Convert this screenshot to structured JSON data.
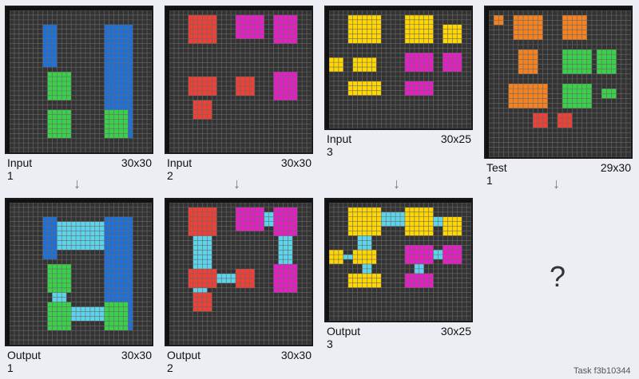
{
  "background": "#eceef4",
  "colors": {
    "0": "#333333",
    "1": "#1e6fd6",
    "2": "#ee4036",
    "3": "#3ad14a",
    "4": "#ffd600",
    "6": "#e51ec3",
    "7": "#f5821f",
    "8": "#5cd4ec"
  },
  "arrow_glyph": "↓",
  "question_mark": "?",
  "task_label": "Task f3b10344",
  "panels": [
    {
      "id": "input-1",
      "label": "Input 1",
      "dims": "30x30",
      "w": 30,
      "h": 30,
      "rects": [
        [
          1,
          3,
          7,
          11,
          9
        ],
        [
          1,
          3,
          20,
          26,
          25
        ],
        [
          3,
          13,
          8,
          18,
          12
        ],
        [
          3,
          21,
          8,
          26,
          12
        ],
        [
          3,
          21,
          20,
          26,
          24
        ]
      ]
    },
    {
      "id": "input-2",
      "label": "Input 2",
      "dims": "30x30",
      "w": 30,
      "h": 30,
      "rects": [
        [
          2,
          1,
          4,
          6,
          9
        ],
        [
          6,
          1,
          14,
          5,
          19
        ],
        [
          6,
          1,
          22,
          6,
          26
        ],
        [
          2,
          14,
          4,
          17,
          9
        ],
        [
          2,
          14,
          14,
          17,
          17
        ],
        [
          6,
          13,
          22,
          18,
          26
        ],
        [
          2,
          19,
          5,
          22,
          8
        ]
      ]
    },
    {
      "id": "input-3",
      "label": "Input 3",
      "dims": "30x25",
      "w": 30,
      "h": 25,
      "rects": [
        [
          4,
          1,
          4,
          6,
          10
        ],
        [
          4,
          1,
          16,
          6,
          21
        ],
        [
          4,
          3,
          24,
          6,
          27
        ],
        [
          4,
          10,
          0,
          12,
          2
        ],
        [
          4,
          10,
          5,
          12,
          9
        ],
        [
          6,
          9,
          16,
          12,
          21
        ],
        [
          6,
          9,
          24,
          12,
          27
        ],
        [
          4,
          15,
          4,
          17,
          10
        ],
        [
          6,
          15,
          16,
          17,
          21
        ]
      ]
    },
    {
      "id": "test-1",
      "label": "Test 1",
      "dims": "29x30",
      "w": 29,
      "h": 30,
      "rects": [
        [
          7,
          1,
          1,
          2,
          2
        ],
        [
          7,
          1,
          5,
          5,
          10
        ],
        [
          7,
          1,
          15,
          5,
          19
        ],
        [
          7,
          8,
          6,
          12,
          9
        ],
        [
          3,
          8,
          15,
          12,
          20
        ],
        [
          3,
          8,
          22,
          12,
          25
        ],
        [
          7,
          15,
          4,
          19,
          11
        ],
        [
          3,
          15,
          15,
          19,
          20
        ],
        [
          3,
          16,
          23,
          17,
          25
        ],
        [
          2,
          21,
          9,
          23,
          11
        ],
        [
          2,
          21,
          14,
          23,
          16
        ]
      ]
    },
    {
      "id": "output-1",
      "label": "Output 1",
      "dims": "30x30",
      "w": 30,
      "h": 30,
      "rects": [
        [
          1,
          3,
          7,
          11,
          9
        ],
        [
          8,
          4,
          10,
          9,
          19
        ],
        [
          1,
          3,
          20,
          26,
          25
        ],
        [
          3,
          13,
          8,
          18,
          12
        ],
        [
          8,
          19,
          9,
          20,
          11
        ],
        [
          3,
          21,
          8,
          26,
          12
        ],
        [
          8,
          22,
          13,
          24,
          19
        ],
        [
          3,
          21,
          20,
          26,
          24
        ]
      ]
    },
    {
      "id": "output-2",
      "label": "Output 2",
      "dims": "30x30",
      "w": 30,
      "h": 30,
      "rects": [
        [
          2,
          1,
          4,
          6,
          9
        ],
        [
          8,
          7,
          5,
          13,
          8
        ],
        [
          6,
          1,
          14,
          5,
          19
        ],
        [
          8,
          2,
          20,
          4,
          21
        ],
        [
          6,
          1,
          22,
          6,
          26
        ],
        [
          8,
          7,
          23,
          12,
          25
        ],
        [
          2,
          14,
          4,
          17,
          9
        ],
        [
          8,
          15,
          10,
          16,
          13
        ],
        [
          2,
          14,
          14,
          17,
          17
        ],
        [
          6,
          13,
          22,
          18,
          26
        ],
        [
          8,
          18,
          5,
          19,
          7
        ],
        [
          2,
          19,
          5,
          22,
          8
        ]
      ]
    },
    {
      "id": "output-3",
      "label": "Output 3",
      "dims": "30x25",
      "w": 30,
      "h": 25,
      "rects": [
        [
          4,
          1,
          4,
          6,
          10
        ],
        [
          8,
          2,
          11,
          4,
          15
        ],
        [
          4,
          1,
          16,
          6,
          21
        ],
        [
          8,
          3,
          22,
          4,
          23
        ],
        [
          4,
          3,
          24,
          6,
          27
        ],
        [
          8,
          7,
          6,
          9,
          8
        ],
        [
          4,
          10,
          0,
          12,
          2
        ],
        [
          8,
          11,
          3,
          11,
          4
        ],
        [
          4,
          10,
          5,
          12,
          9
        ],
        [
          6,
          9,
          16,
          12,
          21
        ],
        [
          8,
          10,
          22,
          11,
          23
        ],
        [
          6,
          9,
          24,
          12,
          27
        ],
        [
          8,
          13,
          7,
          14,
          8
        ],
        [
          8,
          13,
          18,
          14,
          19
        ],
        [
          4,
          15,
          4,
          17,
          10
        ],
        [
          6,
          15,
          16,
          17,
          21
        ]
      ]
    }
  ]
}
